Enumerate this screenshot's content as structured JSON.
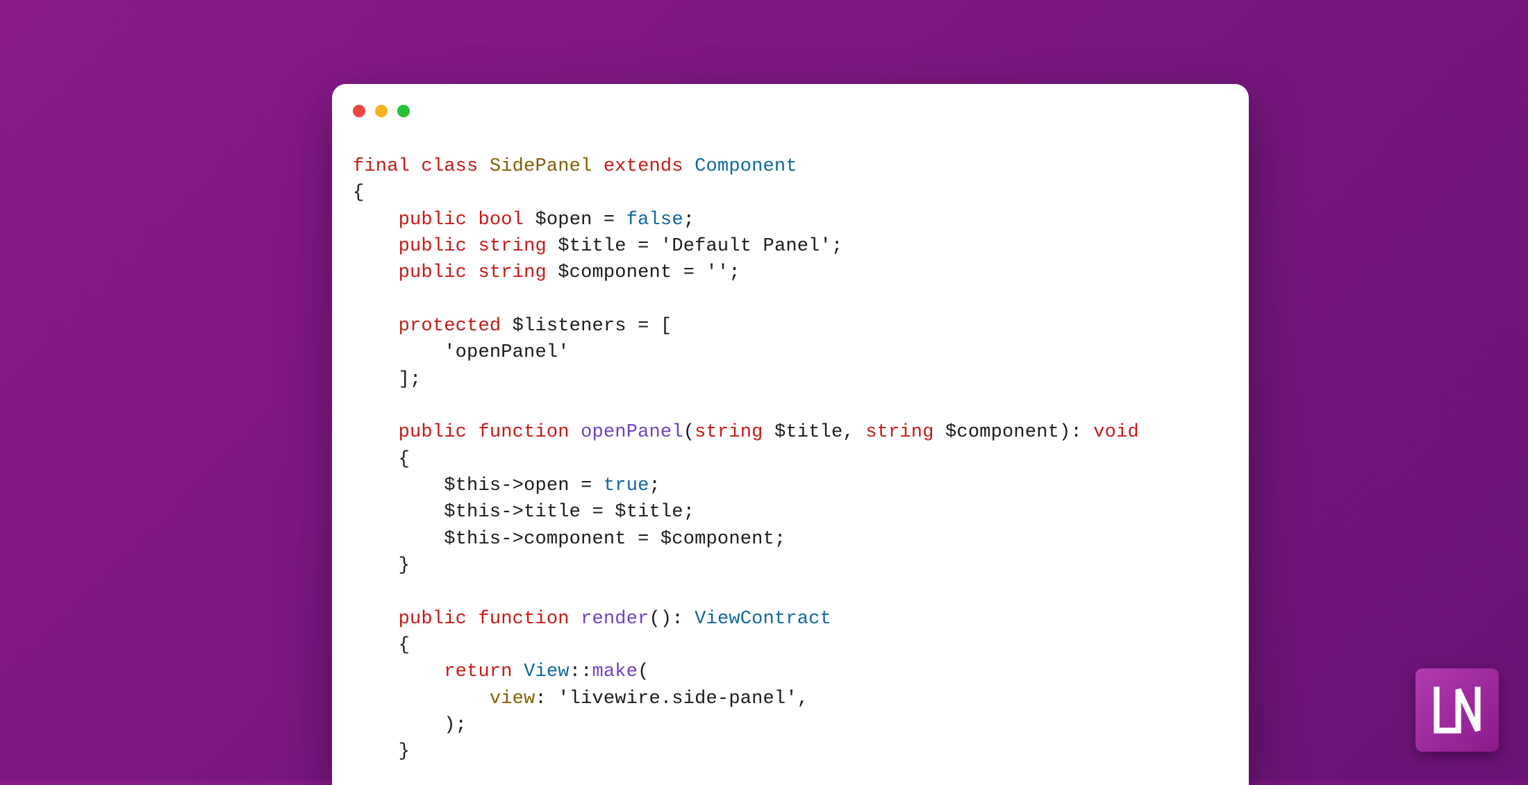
{
  "colors": {
    "bg_gradient_from": "#8a1a8a",
    "bg_gradient_to": "#6a1275",
    "window_bg": "#ffffff",
    "dot_red": "#ec443e",
    "dot_yellow": "#f6b324",
    "dot_green": "#26c138",
    "syntax_keyword": "#c41a16",
    "syntax_name": "#815f03",
    "syntax_class": "#0f68a0",
    "syntax_function": "#6f42c1",
    "syntax_default": "#1b1b1b"
  },
  "logo": {
    "text": "LN"
  },
  "code": {
    "l1": {
      "kw_final": "final",
      "kw_class": "class",
      "name": "SidePanel",
      "kw_extends": "extends",
      "cls": "Component"
    },
    "l2": {
      "brace": "{"
    },
    "l3": {
      "indent": "    ",
      "vis": "public",
      "type": "bool",
      "var": "$open",
      "eq": " = ",
      "val": "false",
      "semi": ";"
    },
    "l4": {
      "indent": "    ",
      "vis": "public",
      "type": "string",
      "var": "$title",
      "eq": " = ",
      "val": "'Default Panel'",
      "semi": ";"
    },
    "l5": {
      "indent": "    ",
      "vis": "public",
      "type": "string",
      "var": "$component",
      "eq": " = ",
      "val": "''",
      "semi": ";"
    },
    "l6": {
      "blank": ""
    },
    "l7": {
      "indent": "    ",
      "vis": "protected",
      "var": "$listeners",
      "eq": " = [",
      "tail": ""
    },
    "l8": {
      "indent": "        ",
      "val": "'openPanel'"
    },
    "l9": {
      "indent": "    ",
      "close": "];"
    },
    "l10": {
      "blank": ""
    },
    "l11": {
      "indent": "    ",
      "vis": "public",
      "kw_fn": "function",
      "fn": "openPanel",
      "sig_open": "(",
      "p1_type": "string",
      "p1_var": " $title",
      "comma1": ", ",
      "p2_type": "string",
      "p2_var": " $component",
      "sig_close": "): ",
      "ret": "void"
    },
    "l12": {
      "indent": "    ",
      "brace": "{"
    },
    "l13": {
      "indent": "        ",
      "this": "$this",
      "arrow": "->",
      "prop": "open",
      "eq": " = ",
      "val": "true",
      "semi": ";"
    },
    "l14": {
      "indent": "        ",
      "this": "$this",
      "arrow": "->",
      "prop": "title",
      "eq": " = ",
      "val": "$title",
      "semi": ";"
    },
    "l15": {
      "indent": "        ",
      "this": "$this",
      "arrow": "->",
      "prop": "component",
      "eq": " = ",
      "val": "$component",
      "semi": ";"
    },
    "l16": {
      "indent": "    ",
      "brace": "}"
    },
    "l17": {
      "blank": ""
    },
    "l18": {
      "indent": "    ",
      "vis": "public",
      "kw_fn": "function",
      "fn": "render",
      "sig": "(): ",
      "ret": "ViewContract"
    },
    "l19": {
      "indent": "    ",
      "brace": "{"
    },
    "l20": {
      "indent": "        ",
      "kw_return": "return",
      "sp": " ",
      "cls": "View",
      "dcolon": "::",
      "fn": "make",
      "open": "("
    },
    "l21": {
      "indent": "            ",
      "label": "view",
      "colon": ": ",
      "val": "'livewire.side-panel'",
      "comma": ","
    },
    "l22": {
      "indent": "        ",
      "close": ");"
    },
    "l23": {
      "indent": "    ",
      "brace": "}"
    }
  }
}
